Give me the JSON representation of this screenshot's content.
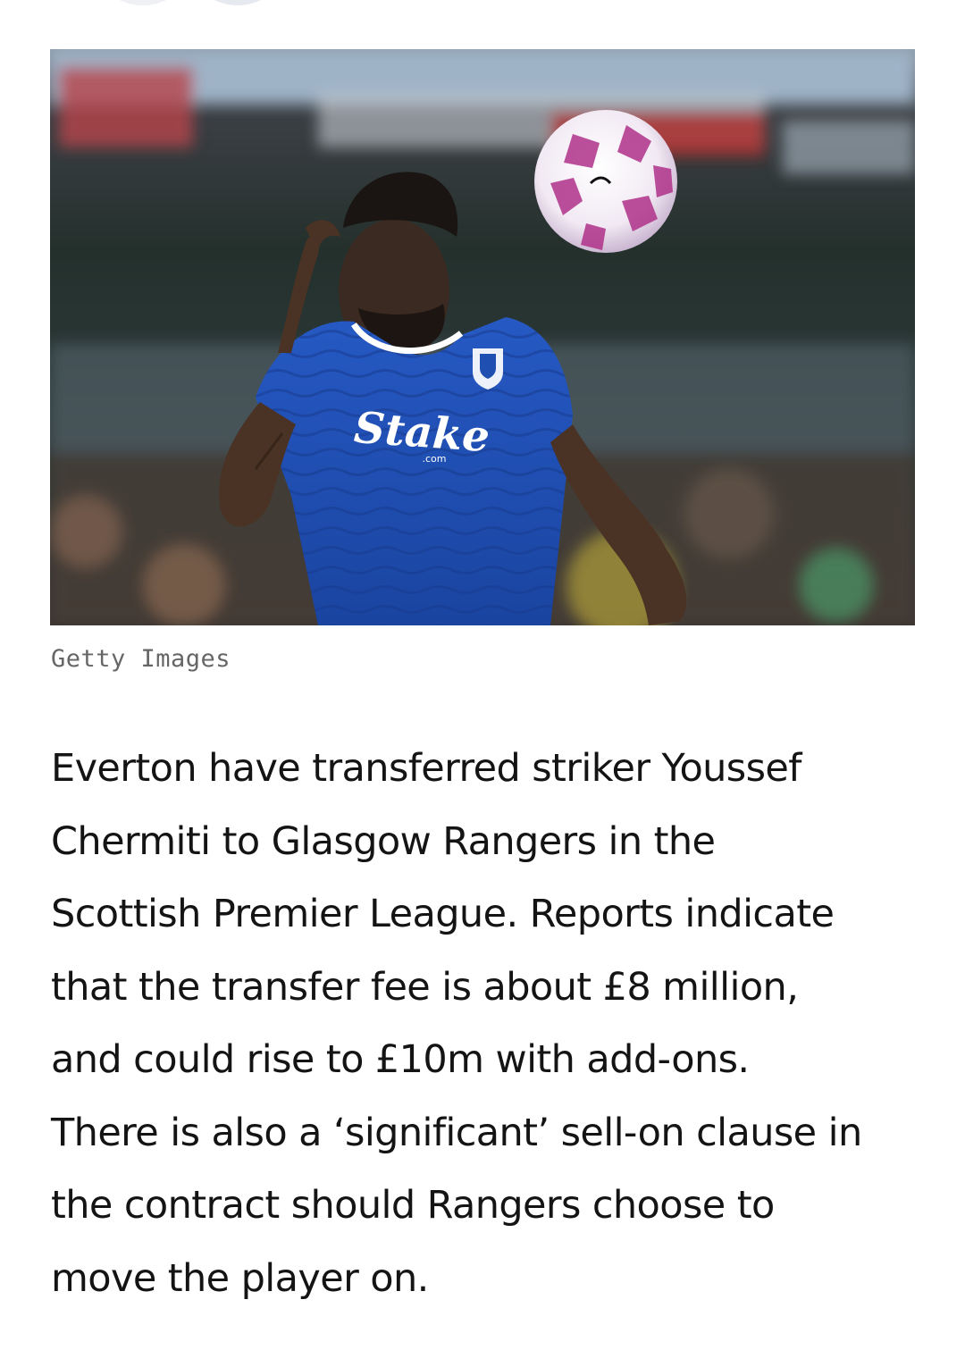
{
  "article": {
    "image": {
      "alt": "Everton player in a blue Stake kit chasing a white and purple football",
      "shirt_sponsor": "Stake",
      "shirt_sponsor_sub": ".com",
      "caption": "Getty Images"
    },
    "body_lines": [
      "Everton have transferred striker Youssef",
      "Chermiti to Glasgow Rangers in the",
      "Scottish Premier League. Reports indicate",
      "that the transfer fee is about £8 million,",
      "and could rise to £10m with add-ons.",
      "There is also a ‘significant’ sell-on clause in",
      "the contract should Rangers choose to",
      "move the player on."
    ]
  },
  "colors": {
    "kit_blue": "#1f4fb0",
    "caption_gray": "#666666",
    "text": "#141414"
  }
}
